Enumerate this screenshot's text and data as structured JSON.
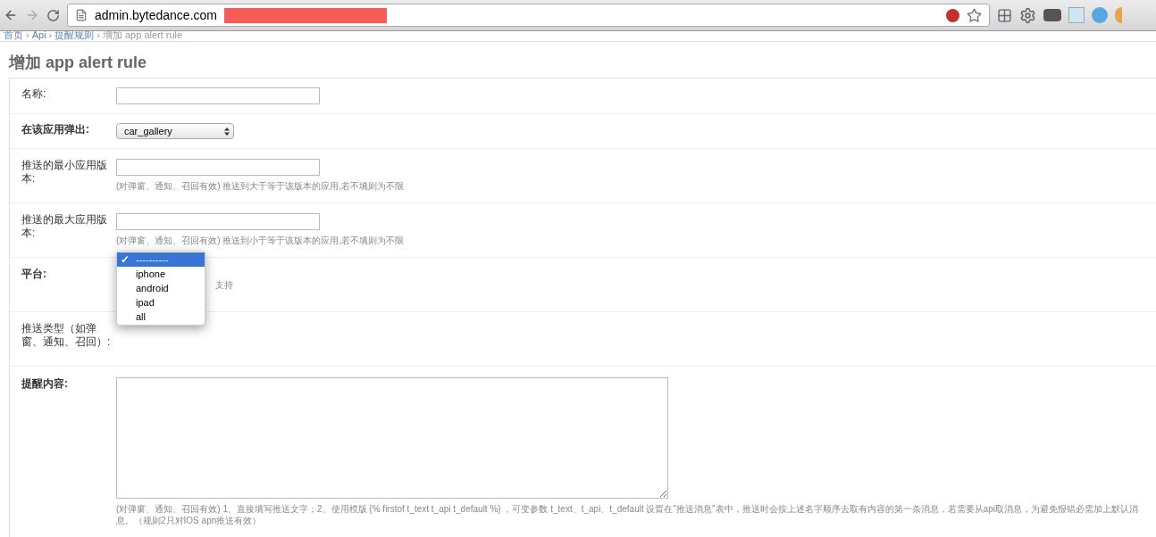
{
  "browser": {
    "url": "admin.bytedance.com"
  },
  "breadcrumbs": [
    {
      "label": "首页",
      "kind": "link"
    },
    {
      "label": "Api",
      "kind": "link"
    },
    {
      "label": "提醒规则",
      "kind": "link"
    },
    {
      "label": "增加 app alert rule",
      "kind": "current"
    }
  ],
  "breadcrumb_separator": "›",
  "page_title": "增加 app alert rule",
  "form_rows": [
    {
      "label": "名称:",
      "kind": "text",
      "bold": false
    },
    {
      "label": "在该应用弹出:",
      "kind": "select",
      "bold": true,
      "value": "car_gallery"
    },
    {
      "label": "推送的最小应用版本:",
      "kind": "text",
      "bold": false,
      "help": "(对弹窗、通知、召回有效) 推送到大于等于该版本的应用,若不填则为不限"
    },
    {
      "label": "推送的最大应用版本:",
      "kind": "text",
      "bold": false,
      "help": "(对弹窗、通知、召回有效) 推送到小于等于该版本的应用,若不填则为不限"
    },
    {
      "label": "平台:",
      "kind": "dropdown",
      "bold": true,
      "help": "支持",
      "options": [
        {
          "label": "----------",
          "selected": true
        },
        {
          "label": "iphone",
          "selected": false
        },
        {
          "label": "android",
          "selected": false
        },
        {
          "label": "ipad",
          "selected": false
        },
        {
          "label": "all",
          "selected": false
        }
      ],
      "check": "✓"
    },
    {
      "label": "推送类型（如弹窗、通知、召回）:",
      "kind": "hidden",
      "bold": false
    },
    {
      "label": "提醒内容:",
      "kind": "textarea",
      "bold": true,
      "help": "(对弹窗、通知、召回有效) 1、直接填写推送文字；2、使用模版 {% firstof t_text t_api t_default %} ，可变参数 t_text、t_api、t_default 设置在\"推送消息\"表中，推送时会按上述名字顺序去取有内容的第一条消息，若需要从api取消息，为避免报错必需加上默认消息。（规则2只对IOS apn推送有效）"
    }
  ]
}
